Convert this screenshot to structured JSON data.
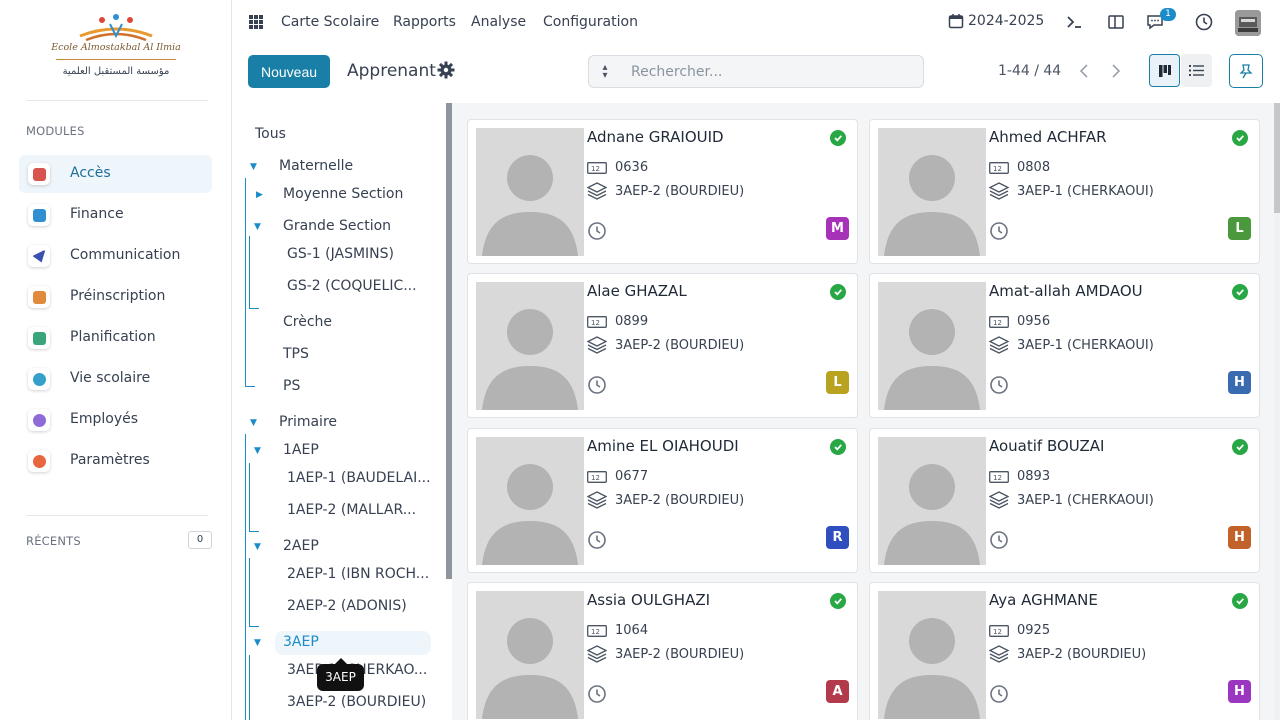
{
  "logo": {
    "name": "Ecole Almostakbal Al Ilmia",
    "arabic": "مؤسسة المستقبل العلمية"
  },
  "sidebar": {
    "modules_title": "MODULES",
    "items": [
      {
        "label": "Accès",
        "color": "#d9534f"
      },
      {
        "label": "Finance",
        "color": "#2f8fd0"
      },
      {
        "label": "Communication",
        "color": "#3a4fb0"
      },
      {
        "label": "Préinscription",
        "color": "#e08a3c"
      },
      {
        "label": "Planification",
        "color": "#3aa57a"
      },
      {
        "label": "Vie scolaire",
        "color": "#35a0c9"
      },
      {
        "label": "Employés",
        "color": "#8e6bd6"
      },
      {
        "label": "Paramètres",
        "color": "#e8663d"
      }
    ],
    "recent_title": "RÉCENTS",
    "recent_count": "0"
  },
  "topbar": {
    "menu": [
      "Carte Scolaire",
      "Rapports",
      "Analyse",
      "Configuration"
    ],
    "year": "2024-2025",
    "messages_badge": "1"
  },
  "control": {
    "new_label": "Nouveau",
    "breadcrumb": "Apprenant",
    "search_placeholder": "Rechercher...",
    "pager": "1-44 / 44"
  },
  "tree": {
    "all": "Tous",
    "maternelle": "Maternelle",
    "moyenne_section": "Moyenne Section",
    "grande_section": "Grande Section",
    "gs1": "GS-1 (JASMINS)",
    "gs2": "GS-2 (COQUELIC...",
    "creche": "Crèche",
    "tps": "TPS",
    "ps": "PS",
    "primaire": "Primaire",
    "aep1": "1AEP",
    "aep1_1": "1AEP-1 (BAUDELAI...",
    "aep1_2": "1AEP-2 (MALLAR...",
    "aep2": "2AEP",
    "aep2_1": "2AEP-1 (IBN ROCH...",
    "aep2_2": "2AEP-2 (ADONIS)",
    "aep3": "3AEP",
    "aep3_1": "3AEP-1 (CHERKAO...",
    "aep3_2": "3AEP-2 (BOURDIEU)",
    "tooltip": "3AEP"
  },
  "students": [
    {
      "name": "Adnane GRAIOUID",
      "id": "0636",
      "class": "3AEP-2 (BOURDIEU)",
      "initial": "M",
      "color": "#a632b8"
    },
    {
      "name": "Ahmed ACHFAR",
      "id": "0808",
      "class": "3AEP-1 (CHERKAOUI)",
      "initial": "L",
      "color": "#4a9a3d"
    },
    {
      "name": "Alae GHAZAL",
      "id": "0899",
      "class": "3AEP-2 (BOURDIEU)",
      "initial": "L",
      "color": "#b8a21f"
    },
    {
      "name": "Amat-allah AMDAOU",
      "id": "0956",
      "class": "3AEP-1 (CHERKAOUI)",
      "initial": "H",
      "color": "#3a6ab0"
    },
    {
      "name": "Amine EL OIAHOUDI",
      "id": "0677",
      "class": "3AEP-2 (BOURDIEU)",
      "initial": "R",
      "color": "#2f4fbf"
    },
    {
      "name": "Aouatif BOUZAI",
      "id": "0893",
      "class": "3AEP-1 (CHERKAOUI)",
      "initial": "H",
      "color": "#c0622a"
    },
    {
      "name": "Assia OULGHAZI",
      "id": "1064",
      "class": "3AEP-2 (BOURDIEU)",
      "initial": "A",
      "color": "#b23a4a"
    },
    {
      "name": "Aya AGHMANE",
      "id": "0925",
      "class": "3AEP-2 (BOURDIEU)",
      "initial": "H",
      "color": "#9b36c0"
    }
  ]
}
